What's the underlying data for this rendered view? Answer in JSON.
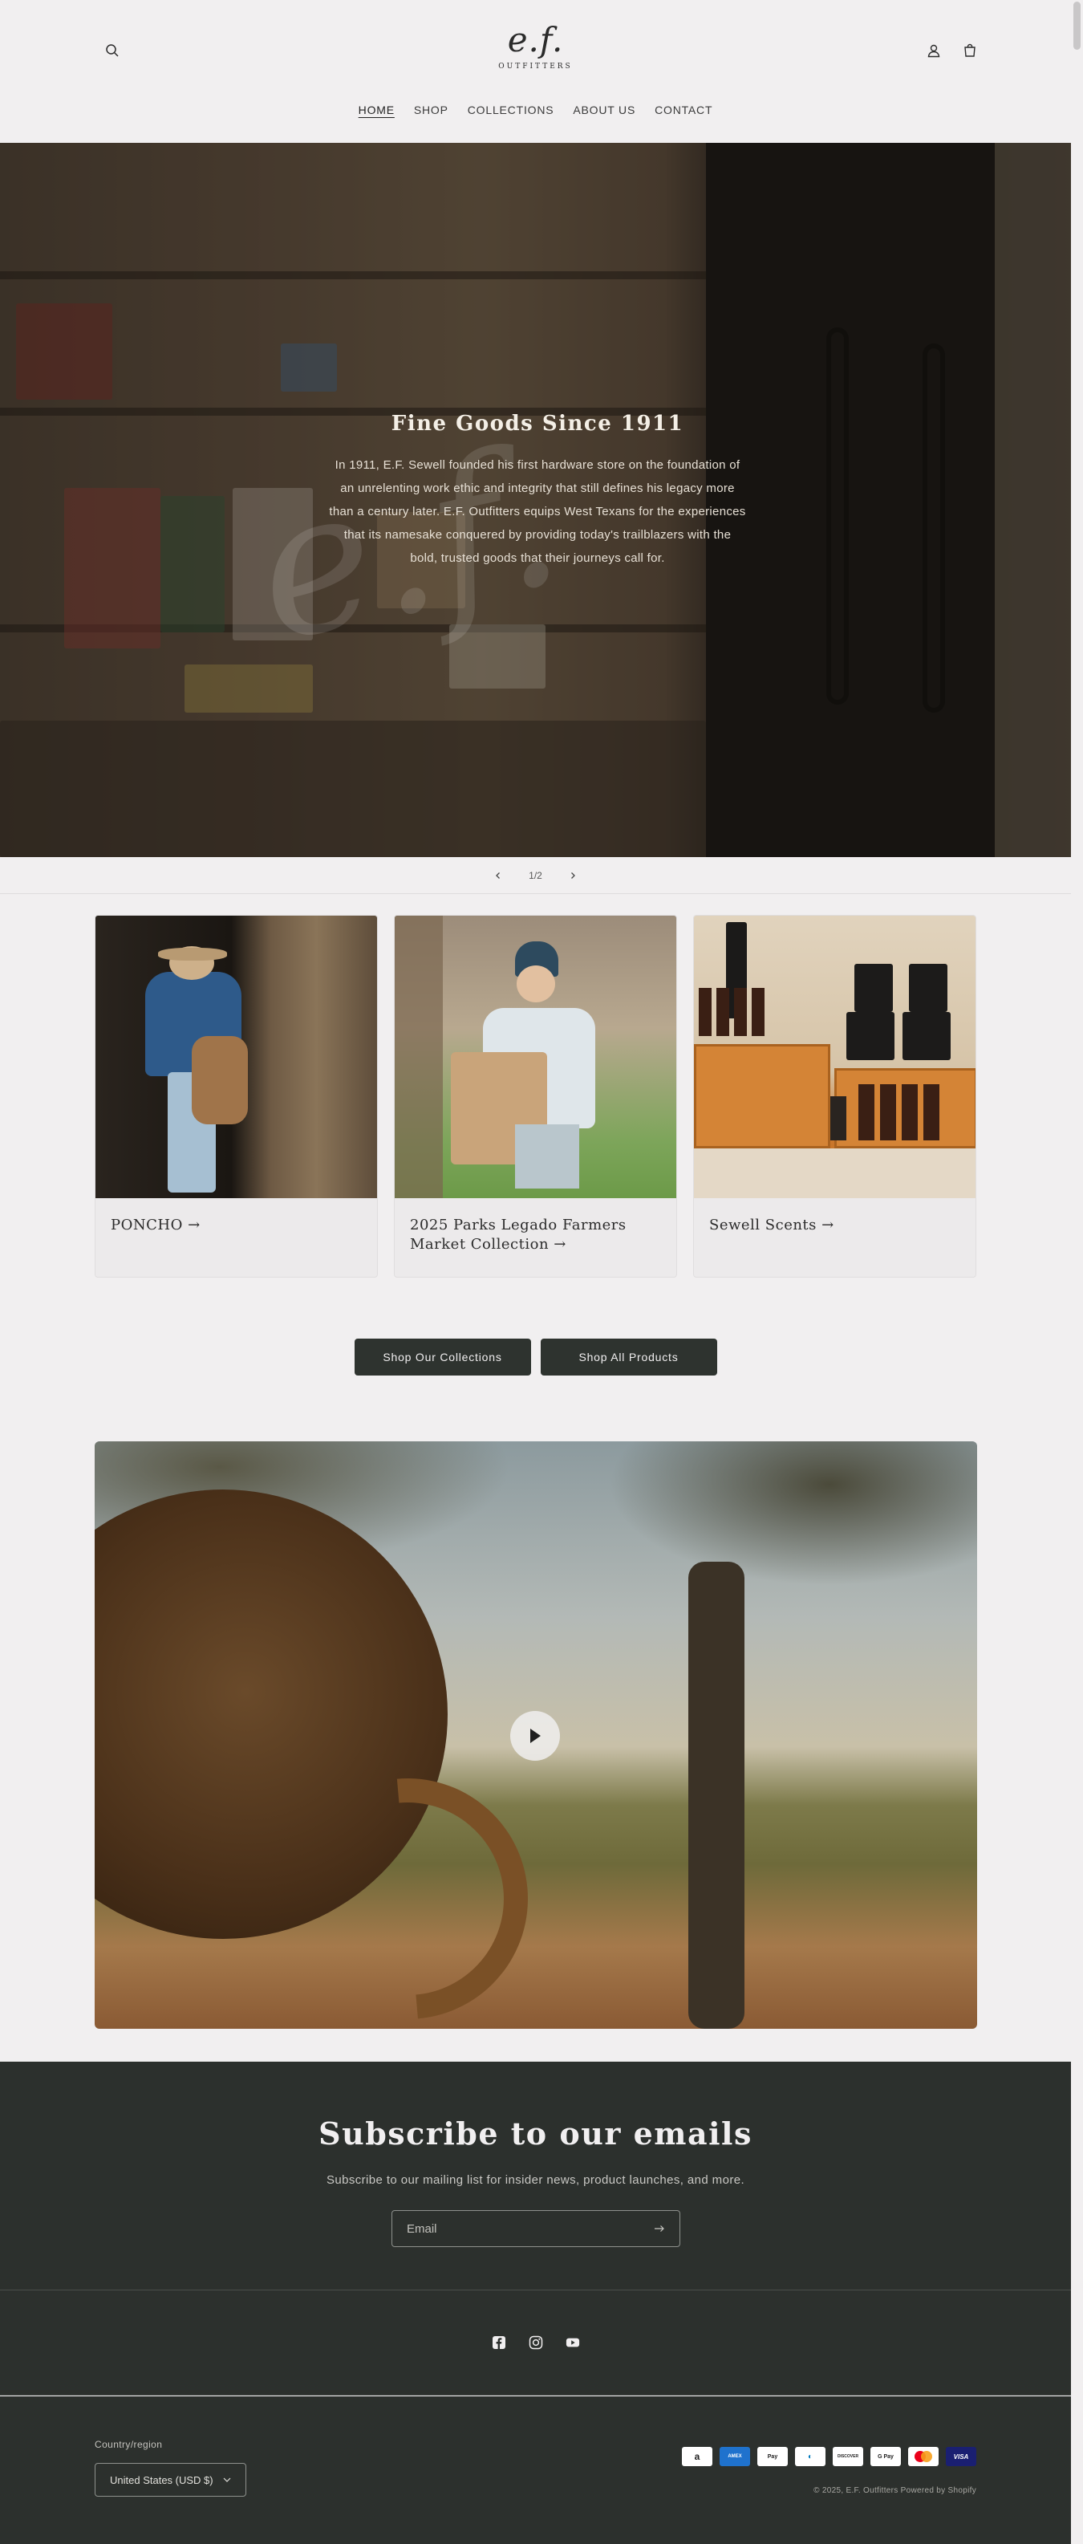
{
  "brand": {
    "logo_mark": "e.f.",
    "logo_text": "OUTFITTERS"
  },
  "header": {
    "icons": [
      "search-icon",
      "account-icon",
      "cart-icon"
    ]
  },
  "nav": {
    "items": [
      {
        "label": "HOME",
        "active": true
      },
      {
        "label": "SHOP",
        "active": false
      },
      {
        "label": "COLLECTIONS",
        "active": false
      },
      {
        "label": "ABOUT US",
        "active": false
      },
      {
        "label": "CONTACT",
        "active": false
      }
    ]
  },
  "hero": {
    "title": "Fine Goods Since 1911",
    "text": "In 1911, E.F. Sewell founded his first hardware store on the foundation of an unrelenting work ethic and integrity that still defines his legacy more than a century later. E.F. Outfitters equips West Texans for the experiences that its namesake conquered by providing today's trailblazers with the bold, trusted goods that their journeys call for.",
    "slide_counter": "1/2",
    "current_slide": 1,
    "total_slides": 2
  },
  "collections": [
    {
      "title": "PONCHO →"
    },
    {
      "title": "2025 Parks Legado Farmers Market Collection →"
    },
    {
      "title": "Sewell Scents →"
    }
  ],
  "buttons": {
    "collections": "Shop Our Collections",
    "products": "Shop All Products"
  },
  "video": {
    "play_icon": "play-icon"
  },
  "newsletter": {
    "title": "Subscribe to our emails",
    "subtitle": "Subscribe to our mailing list for insider news, product launches, and more.",
    "email_placeholder": "Email"
  },
  "social": [
    "facebook-icon",
    "instagram-icon",
    "youtube-icon"
  ],
  "footer": {
    "country_label": "Country/region",
    "country_value": "United States (USD $)",
    "payments": [
      "Amazon",
      "American Express",
      "Apple Pay",
      "Diners Club",
      "Discover",
      "Google Pay",
      "Mastercard",
      "Visa"
    ],
    "copyright": "© 2025, E.F. Outfitters Powered by Shopify"
  },
  "colors": {
    "background": "#f1eff0",
    "dark": "#2c302d",
    "button": "#2e332f"
  }
}
